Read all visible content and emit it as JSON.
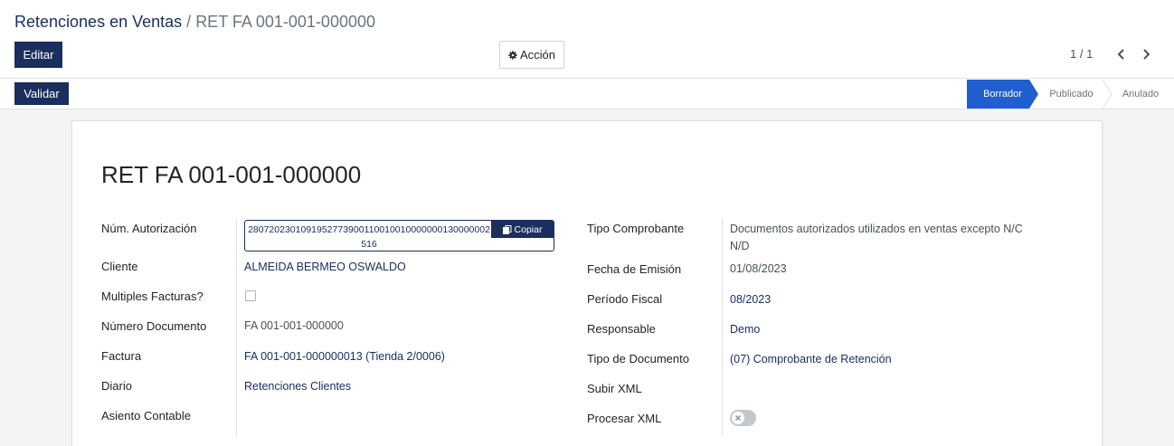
{
  "breadcrumb": {
    "root": "Retenciones en Ventas",
    "separator": "/",
    "current": "RET FA 001-001-000000"
  },
  "toolbar": {
    "edit_label": "Editar",
    "action_label": "Acción",
    "action_icon": "gear-icon",
    "pager": "1 / 1"
  },
  "statusbar": {
    "validate_label": "Validar",
    "stages": [
      "Borrador",
      "Publicado",
      "Anulado"
    ],
    "active_stage": "Borrador",
    "active_color": "#1f5fcf"
  },
  "form": {
    "title": "RET FA 001-001-000000",
    "left": {
      "authorization_label": "Núm. Autorización",
      "authorization_value": "2807202301091952773900110010010000000130000002516",
      "copy_label": "Copiar",
      "client_label": "Cliente",
      "client_value": "ALMEIDA BERMEO OSWALDO",
      "multiple_label": "Multiples Facturas?",
      "multiple_checked": false,
      "number_label": "Número Documento",
      "number_value": "FA 001-001-000000",
      "invoice_label": "Factura",
      "invoice_value": "FA 001-001-000000013 (Tienda 2/0006)",
      "journal_label": "Diario",
      "journal_value": "Retenciones Clientes",
      "entry_label": "Asiento Contable",
      "entry_value": ""
    },
    "right": {
      "voucher_type_label": "Tipo Comprobante",
      "voucher_type_value_1": "Documentos autorizados utilizados en ventas excepto N/C",
      "voucher_type_value_2": "N/D",
      "date_label": "Fecha de Emisión",
      "date_value": "01/08/2023",
      "period_label": "Período Fiscal",
      "period_value": "08/2023",
      "responsible_label": "Responsable",
      "responsible_value": "Demo",
      "doc_type_label": "Tipo de Documento",
      "doc_type_value": "(07) Comprobante de Retención",
      "upload_xml_label": "Subir XML",
      "process_xml_label": "Procesar XML",
      "process_xml_enabled": false
    }
  },
  "colors": {
    "primary": "#1b2f5e",
    "link": "#1a3062"
  }
}
